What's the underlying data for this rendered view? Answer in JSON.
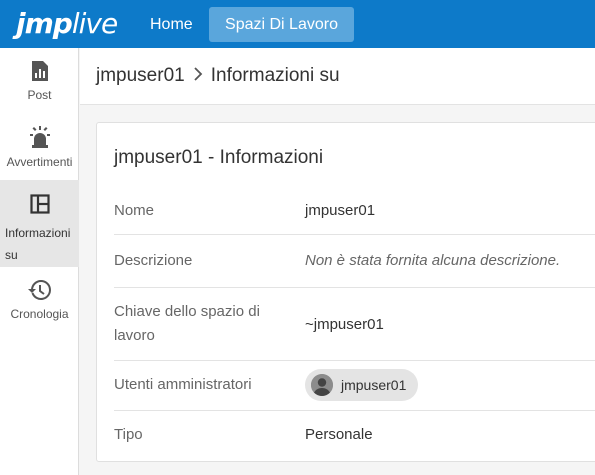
{
  "app": {
    "logo_jmp": "jmp",
    "logo_live": "live"
  },
  "nav": {
    "home": "Home",
    "spazi": "Spazi Di Lavoro"
  },
  "sidebar": {
    "items": [
      {
        "label": "Post",
        "icon": "chart-icon"
      },
      {
        "label": "Avvertimenti",
        "icon": "alarm-icon"
      },
      {
        "label": "Informazioni su",
        "icon": "layout-icon",
        "active": true
      },
      {
        "label": "Cronologia",
        "icon": "history-icon"
      }
    ]
  },
  "breadcrumb": {
    "user": "jmpuser01",
    "page": "Informazioni su"
  },
  "card": {
    "title": "jmpuser01 - Informazioni",
    "rows": [
      {
        "key": "Nome",
        "value": "jmpuser01"
      },
      {
        "key": "Descrizione",
        "value": "Non è stata fornita alcuna descrizione."
      },
      {
        "key": "Chiave dello spazio di lavoro",
        "value": "~jmpuser01"
      },
      {
        "key": "Utenti amministratori",
        "value": "jmpuser01"
      },
      {
        "key": "Tipo",
        "value": "Personale"
      }
    ]
  },
  "colors": {
    "topbar": "#0d7ac9",
    "nav_active": "#5aa6dc",
    "sidebar_active": "#e6e6e6"
  }
}
